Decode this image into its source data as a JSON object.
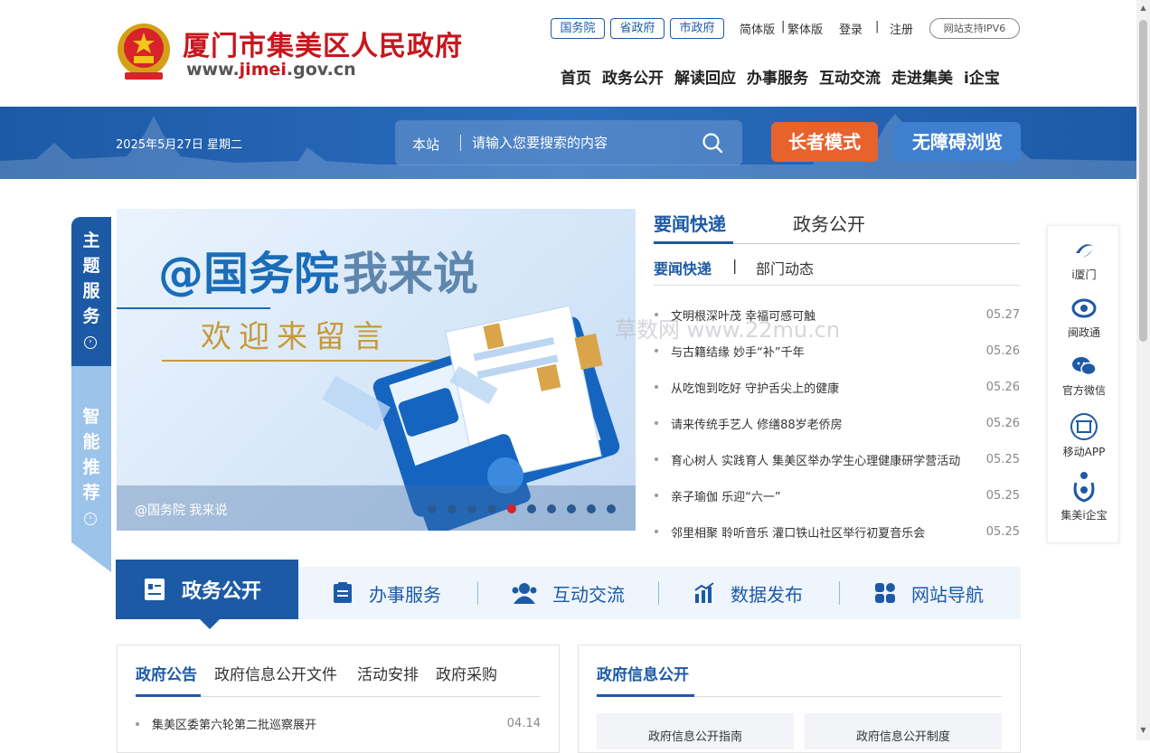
{
  "header": {
    "site_name": "厦门市集美区人民政府",
    "site_url_prefix": "www.",
    "site_url_highlight": "jimei",
    "site_url_suffix": ".gov.cn",
    "top_links": [
      "国务院",
      "省政府",
      "市政府"
    ],
    "lang_simplified": "简体版",
    "lang_traditional": "繁体版",
    "login": "登录",
    "register": "注册",
    "ipv6": "网站支持IPV6",
    "nav": [
      "首页",
      "政务公开",
      "解读回应",
      "办事服务",
      "互动交流",
      "走进集美",
      "i企宝"
    ]
  },
  "band": {
    "date": "2025年5月27日 星期二",
    "search_scope": "本站",
    "search_placeholder": "请输入您要搜索的内容",
    "elder_mode": "长者模式",
    "accessible": "无障碍浏览"
  },
  "side_tabs": {
    "tab1": [
      "主",
      "题",
      "服",
      "务"
    ],
    "tab2": [
      "智",
      "能",
      "推",
      "荐"
    ]
  },
  "carousel": {
    "title_a": "@国务院",
    "title_b": "我来说",
    "subtitle": "欢迎来留言",
    "caption": "@国务院 我来说",
    "dot_count": 10,
    "active_dot": 4
  },
  "news": {
    "tabs": [
      "要闻快递",
      "政务公开"
    ],
    "subtabs": [
      "要闻快递",
      "部门动态"
    ],
    "items": [
      {
        "title": "文明根深叶茂 幸福可感可触",
        "date": "05.27"
      },
      {
        "title": "与古籍结缘 妙手“补”千年",
        "date": "05.26"
      },
      {
        "title": "从吃饱到吃好 守护舌尖上的健康",
        "date": "05.26"
      },
      {
        "title": "请来传统手艺人 修缮88岁老侨房",
        "date": "05.26"
      },
      {
        "title": "育心树人 实践育人 集美区举办学生心理健康研学营活动",
        "date": "05.25"
      },
      {
        "title": "亲子瑜伽 乐迎“六一”",
        "date": "05.25"
      },
      {
        "title": "邻里相聚 聆听音乐 灌口铁山社区举行初夏音乐会",
        "date": "05.25"
      }
    ]
  },
  "float_bar": [
    "i厦门",
    "闽政通",
    "官方微信",
    "移动APP",
    "集美i企宝"
  ],
  "watermark": "草数网 www.22mu.cn",
  "main_nav": [
    "政务公开",
    "办事服务",
    "互动交流",
    "数据发布",
    "网站导航"
  ],
  "box_left": {
    "tabs": [
      "政府公告",
      "政府信息公开文件",
      "活动安排",
      "政府采购"
    ],
    "items": [
      {
        "title": "集美区委第六轮第二批巡察展开",
        "date": "04.14"
      }
    ]
  },
  "box_right": {
    "title": "政府信息公开",
    "cards": [
      "政府信息公开指南",
      "政府信息公开制度"
    ]
  },
  "colors": {
    "primary": "#1d5aa6",
    "red": "#c8161d",
    "orange": "#e8622c"
  }
}
